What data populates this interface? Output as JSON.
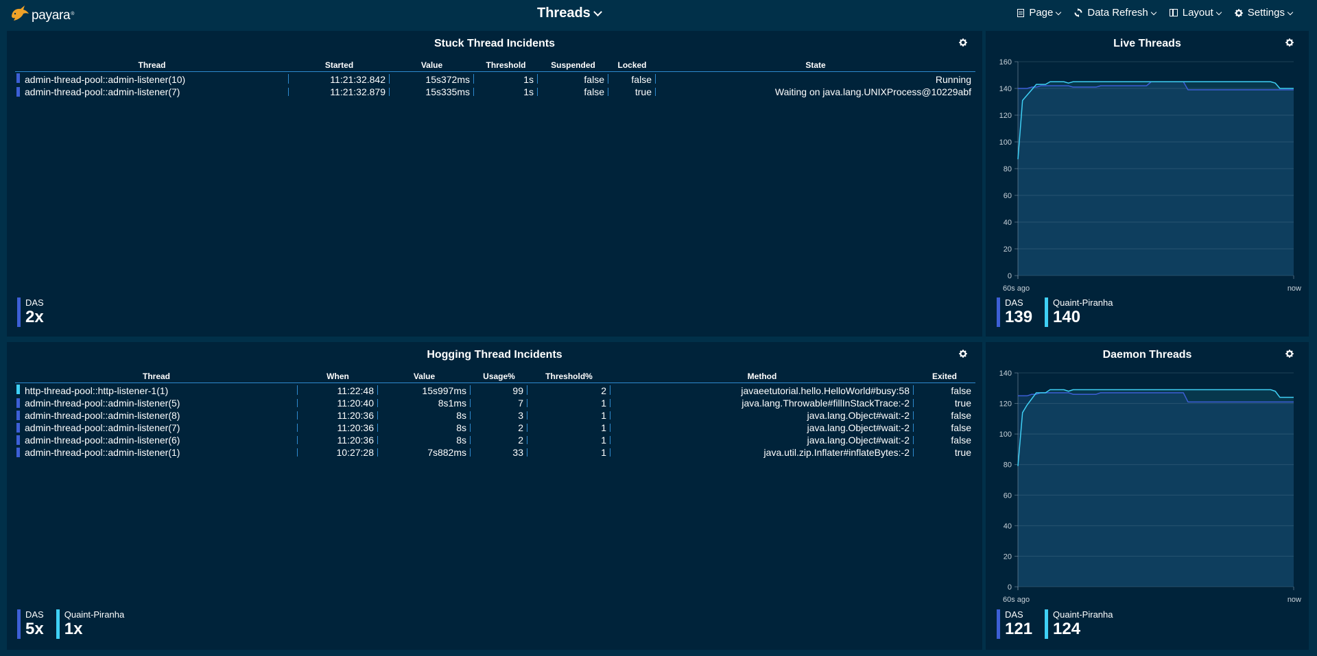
{
  "header": {
    "logo_text": "payara",
    "logo_reg": "®",
    "title": "Threads",
    "menu": [
      {
        "label": "Page",
        "icon": "page-icon"
      },
      {
        "label": "Data Refresh",
        "icon": "refresh-icon"
      },
      {
        "label": "Layout",
        "icon": "layout-icon"
      },
      {
        "label": "Settings",
        "icon": "gear-icon"
      }
    ]
  },
  "colors": {
    "das": "#3d5fd6",
    "quaint_piranha": "#3fd0f5",
    "table_separator": "#2e8bd0",
    "panel_bg": "#00233a",
    "page_bg": "#013049"
  },
  "stuck": {
    "title": "Stuck Thread Incidents",
    "columns": [
      "Thread",
      "Started",
      "Value",
      "Threshold",
      "Suspended",
      "Locked",
      "State"
    ],
    "rows": [
      {
        "series": "das",
        "cells": [
          "admin-thread-pool::admin-listener(10)",
          "11:21:32.842",
          "15s372ms",
          "1s",
          "false",
          "false",
          "Running"
        ]
      },
      {
        "series": "das",
        "cells": [
          "admin-thread-pool::admin-listener(7)",
          "11:21:32.879",
          "15s335ms",
          "1s",
          "false",
          "true",
          "Waiting on java.lang.UNIXProcess@10229abf"
        ]
      }
    ],
    "stats": [
      {
        "series": "das",
        "label": "DAS",
        "value": "2x"
      }
    ]
  },
  "hogging": {
    "title": "Hogging Thread Incidents",
    "columns": [
      "Thread",
      "When",
      "Value",
      "Usage%",
      "Threshold%",
      "Method",
      "Exited"
    ],
    "rows": [
      {
        "series": "quaint_piranha",
        "cells": [
          "http-thread-pool::http-listener-1(1)",
          "11:22:48",
          "15s997ms",
          "99",
          "2",
          "javaeetutorial.hello.HelloWorld#busy:58",
          "false"
        ]
      },
      {
        "series": "das",
        "cells": [
          "admin-thread-pool::admin-listener(5)",
          "11:20:40",
          "8s1ms",
          "7",
          "1",
          "java.lang.Throwable#fillInStackTrace:-2",
          "true"
        ]
      },
      {
        "series": "das",
        "cells": [
          "admin-thread-pool::admin-listener(8)",
          "11:20:36",
          "8s",
          "3",
          "1",
          "java.lang.Object#wait:-2",
          "false"
        ]
      },
      {
        "series": "das",
        "cells": [
          "admin-thread-pool::admin-listener(7)",
          "11:20:36",
          "8s",
          "2",
          "1",
          "java.lang.Object#wait:-2",
          "false"
        ]
      },
      {
        "series": "das",
        "cells": [
          "admin-thread-pool::admin-listener(6)",
          "11:20:36",
          "8s",
          "2",
          "1",
          "java.lang.Object#wait:-2",
          "false"
        ]
      },
      {
        "series": "das",
        "cells": [
          "admin-thread-pool::admin-listener(1)",
          "10:27:28",
          "7s882ms",
          "33",
          "1",
          "java.util.zip.Inflater#inflateBytes:-2",
          "true"
        ]
      }
    ],
    "stats": [
      {
        "series": "das",
        "label": "DAS",
        "value": "5x"
      },
      {
        "series": "quaint_piranha",
        "label": "Quaint-Piranha",
        "value": "1x"
      }
    ]
  },
  "live": {
    "title": "Live Threads",
    "stats": [
      {
        "series": "das",
        "label": "DAS",
        "value": "139"
      },
      {
        "series": "quaint_piranha",
        "label": "Quaint-Piranha",
        "value": "140"
      }
    ]
  },
  "daemon": {
    "title": "Daemon Threads",
    "stats": [
      {
        "series": "das",
        "label": "DAS",
        "value": "121"
      },
      {
        "series": "quaint_piranha",
        "label": "Quaint-Piranha",
        "value": "124"
      }
    ]
  },
  "chart_data": [
    {
      "type": "area",
      "title": "Live Threads",
      "xlabel": "",
      "ylabel": "",
      "x_tick_labels": [
        "60s ago",
        "now"
      ],
      "x_range": [
        0,
        60
      ],
      "ylim": [
        0,
        160
      ],
      "yticks": [
        0,
        20,
        40,
        60,
        80,
        100,
        120,
        140,
        160
      ],
      "grid": true,
      "legend": "bottom-left",
      "x": [
        0,
        1,
        2,
        3,
        4,
        5,
        6,
        7,
        8,
        9,
        10,
        11,
        12,
        13,
        14,
        15,
        16,
        17,
        18,
        19,
        20,
        21,
        22,
        23,
        24,
        25,
        26,
        27,
        28,
        29,
        30,
        31,
        32,
        33,
        34,
        35,
        36,
        37,
        38,
        39,
        40,
        45,
        50,
        51,
        52,
        53,
        54,
        55,
        56,
        57,
        58,
        59,
        60
      ],
      "series": [
        {
          "name": "DAS",
          "values": [
            140,
            140,
            140,
            141,
            141,
            142,
            142,
            142,
            142,
            142,
            142,
            142,
            141,
            141,
            141,
            141,
            141,
            141,
            142,
            142,
            142,
            142,
            142,
            142,
            142,
            142,
            142,
            142,
            142,
            145,
            145,
            145,
            145,
            145,
            145,
            145,
            145,
            139,
            139,
            139,
            139,
            139,
            139,
            139,
            139,
            139,
            139,
            139,
            139,
            139,
            139,
            139,
            139
          ]
        },
        {
          "name": "Quaint-Piranha",
          "values": [
            87,
            131,
            135,
            139,
            143,
            143,
            143,
            145,
            145,
            145,
            145,
            144,
            145,
            145,
            145,
            145,
            145,
            145,
            145,
            145,
            145,
            145,
            145,
            145,
            145,
            145,
            145,
            145,
            145,
            145,
            145,
            145,
            145,
            145,
            145,
            145,
            145,
            145,
            145,
            145,
            145,
            145,
            145,
            145,
            145,
            145,
            145,
            145,
            144,
            140,
            140,
            140,
            140
          ]
        }
      ]
    },
    {
      "type": "area",
      "title": "Daemon Threads",
      "xlabel": "",
      "ylabel": "",
      "x_tick_labels": [
        "60s ago",
        "now"
      ],
      "x_range": [
        0,
        60
      ],
      "ylim": [
        0,
        140
      ],
      "yticks": [
        0,
        20,
        40,
        60,
        80,
        100,
        120,
        140
      ],
      "grid": true,
      "legend": "bottom-left",
      "x": [
        0,
        1,
        2,
        3,
        4,
        5,
        6,
        7,
        8,
        9,
        10,
        11,
        12,
        13,
        14,
        15,
        16,
        17,
        18,
        19,
        20,
        21,
        22,
        23,
        24,
        25,
        26,
        27,
        28,
        29,
        30,
        31,
        32,
        33,
        34,
        35,
        36,
        37,
        38,
        39,
        40,
        45,
        50,
        51,
        52,
        53,
        54,
        55,
        56,
        57,
        58,
        59,
        60
      ],
      "series": [
        {
          "name": "DAS",
          "values": [
            125,
            125,
            125,
            126,
            126,
            127,
            127,
            127,
            127,
            127,
            127,
            127,
            126,
            126,
            126,
            126,
            126,
            126,
            127,
            127,
            127,
            127,
            127,
            127,
            127,
            127,
            127,
            127,
            127,
            127,
            127,
            127,
            127,
            127,
            127,
            127,
            127,
            121,
            121,
            121,
            121,
            121,
            121,
            121,
            121,
            121,
            121,
            121,
            121,
            121,
            121,
            121,
            121
          ]
        },
        {
          "name": "Quaint-Piranha",
          "values": [
            79,
            114,
            119,
            123,
            127,
            127,
            127,
            129,
            129,
            129,
            129,
            128,
            129,
            129,
            129,
            129,
            129,
            129,
            129,
            129,
            129,
            129,
            129,
            129,
            129,
            129,
            129,
            129,
            129,
            129,
            129,
            129,
            129,
            129,
            129,
            129,
            129,
            129,
            129,
            129,
            129,
            129,
            129,
            129,
            129,
            129,
            129,
            129,
            128,
            124,
            124,
            124,
            124
          ]
        }
      ]
    }
  ]
}
